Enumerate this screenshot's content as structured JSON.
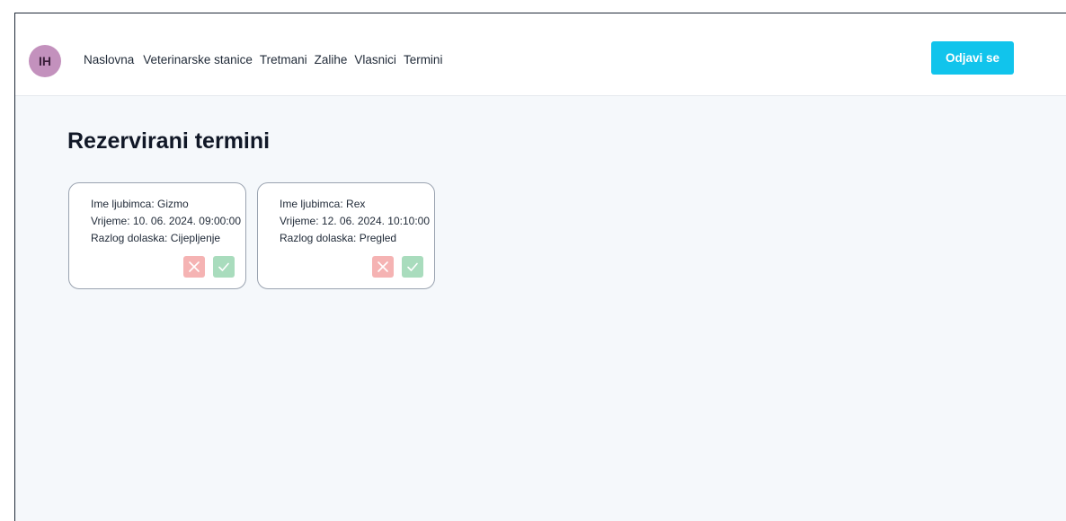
{
  "user": {
    "initials": "IH"
  },
  "nav": {
    "items": [
      "Naslovna",
      "Veterinarske stanice",
      "Tretmani",
      "Zalihe",
      "Vlasnici",
      "Termini"
    ],
    "logout_label": "Odjavi se"
  },
  "page": {
    "title": "Rezervirani termini"
  },
  "appointments": [
    {
      "pet": "Ime ljubimca: Gizmo",
      "time": "Vrijeme: 10. 06. 2024. 09:00:00",
      "reason": "Razlog dolaska: Cijepljenje"
    },
    {
      "pet": "Ime ljubimca: Rex",
      "time": "Vrijeme: 12. 06. 2024. 10:10:00",
      "reason": "Razlog dolaska: Pregled"
    }
  ],
  "icons": {
    "reject": "close-icon",
    "accept": "check-icon"
  },
  "colors": {
    "accent": "#11c4ec",
    "avatar": "#c391bd",
    "reject": "#f5b3b3",
    "accept": "#a9dcbd",
    "background": "#f5f8fb"
  }
}
